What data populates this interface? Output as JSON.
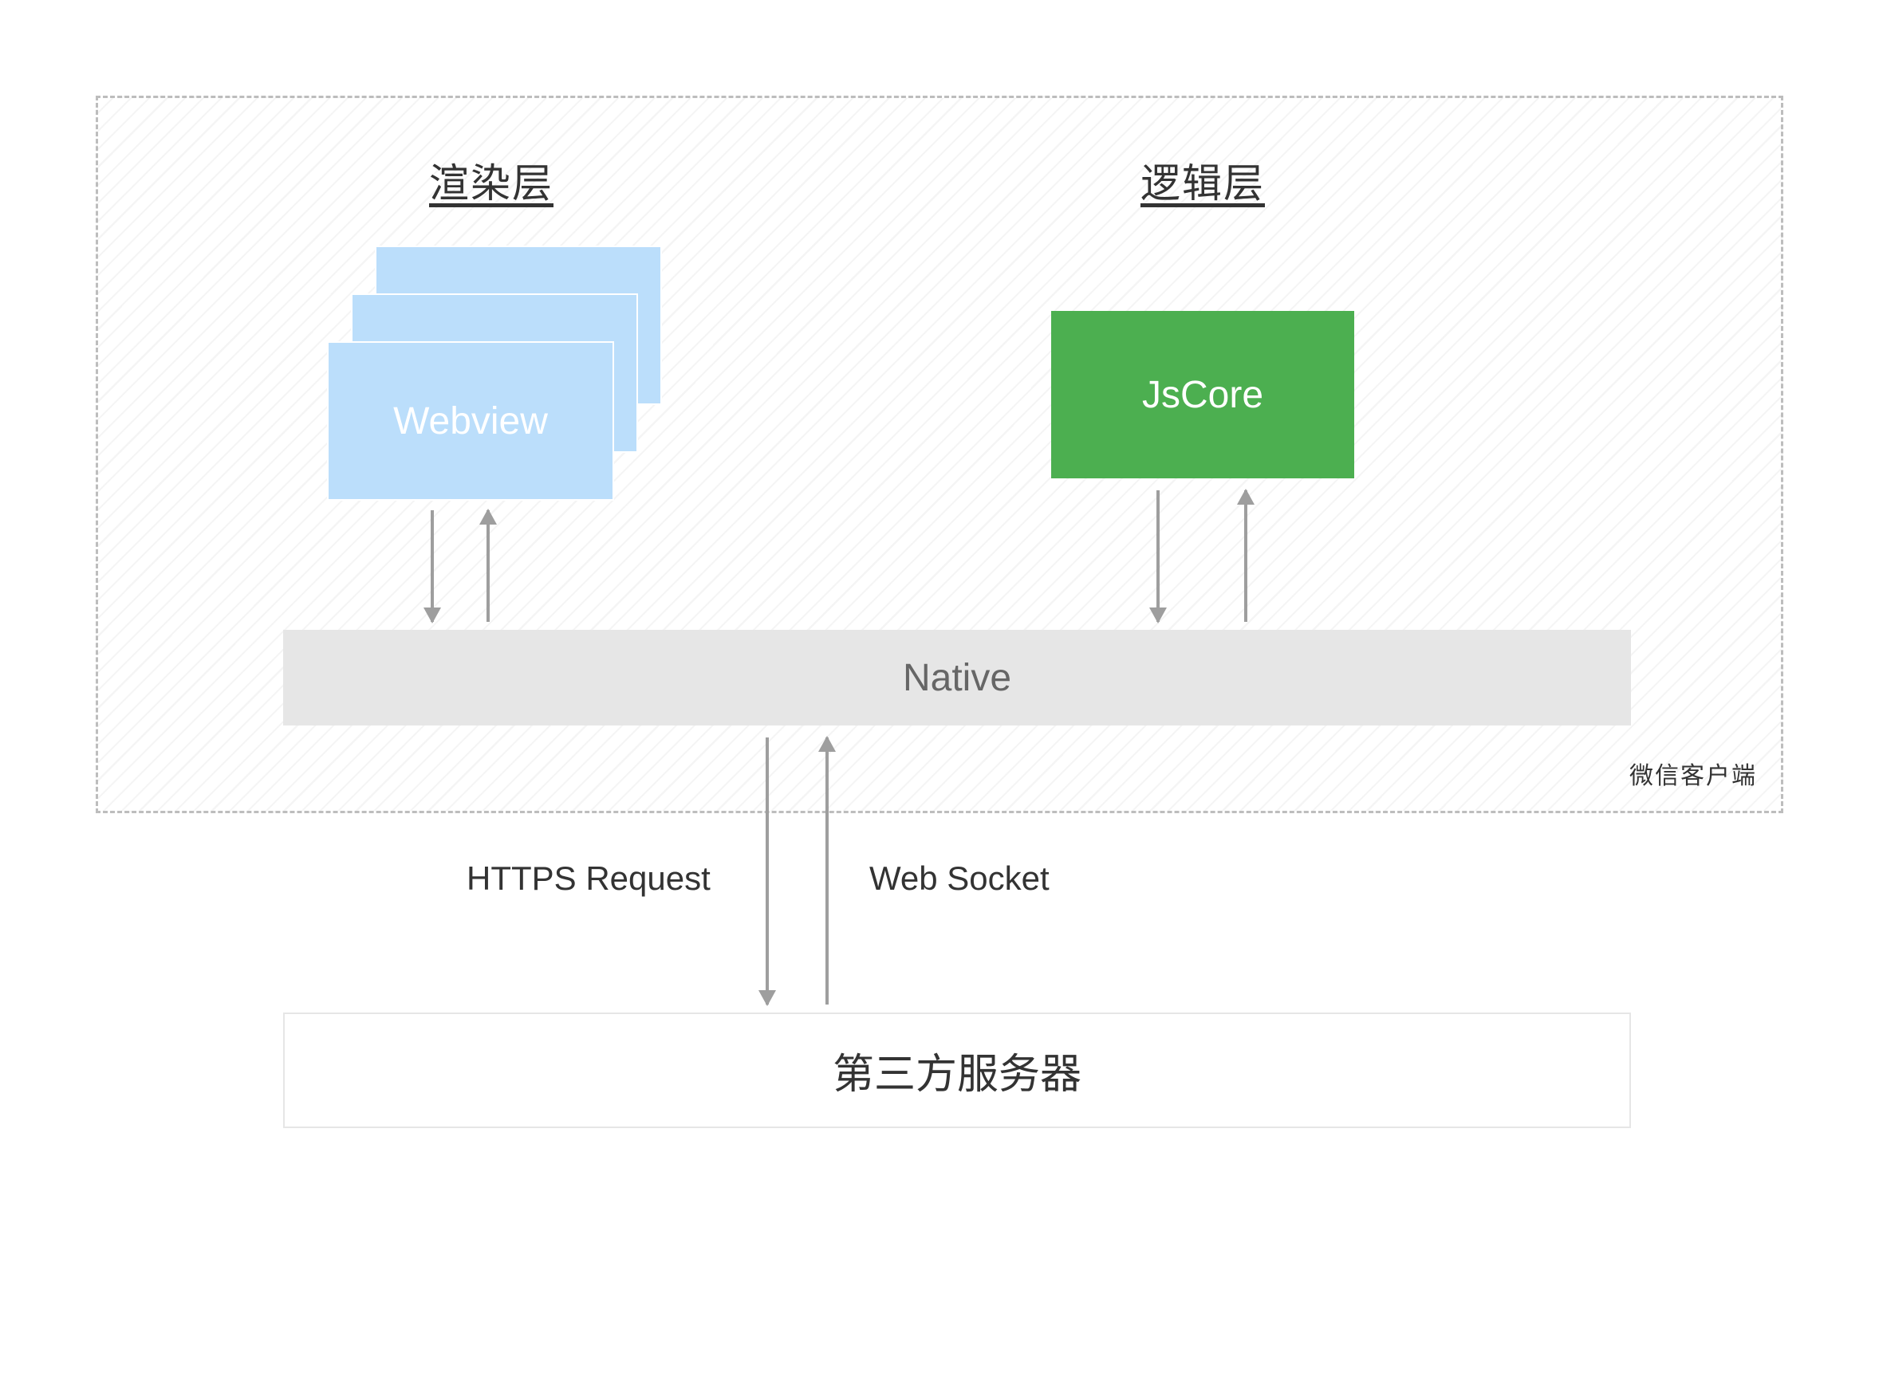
{
  "titles": {
    "render_layer": "渲染层",
    "logic_layer": "逻辑层"
  },
  "boxes": {
    "webview": "Webview",
    "jscore": "JsCore",
    "native": "Native",
    "server": "第三方服务器"
  },
  "labels": {
    "client": "微信客户端",
    "https_request": "HTTPS Request",
    "web_socket": "Web Socket"
  }
}
